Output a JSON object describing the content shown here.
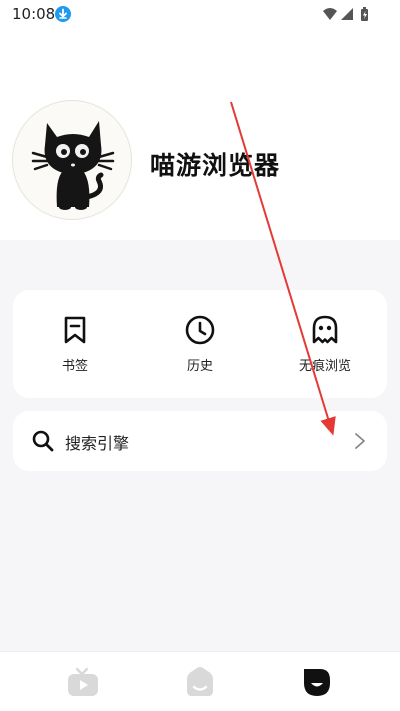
{
  "status_bar": {
    "time": "10:08",
    "icons": [
      "download-icon",
      "wifi-icon",
      "signal-icon",
      "battery-icon"
    ]
  },
  "profile": {
    "avatar": "black-cat-avatar",
    "app_name": "喵游浏览器"
  },
  "quick_actions": [
    {
      "label": "书签",
      "icon": "bookmark-icon"
    },
    {
      "label": "历史",
      "icon": "clock-icon"
    },
    {
      "label": "无痕浏览",
      "icon": "ghost-icon"
    }
  ],
  "settings": {
    "search_engine_label": "搜索引擎"
  },
  "bottom_nav": {
    "items": [
      {
        "icon": "tv-icon",
        "active": false
      },
      {
        "icon": "home-icon",
        "active": false
      },
      {
        "icon": "profile-icon",
        "active": true
      }
    ]
  },
  "colors": {
    "accent": "#111111",
    "inactive_nav": "#d9d9d9",
    "background": "#f6f6f8",
    "annotation_arrow": "#e53935",
    "download_badge": "#1e9bf0"
  }
}
